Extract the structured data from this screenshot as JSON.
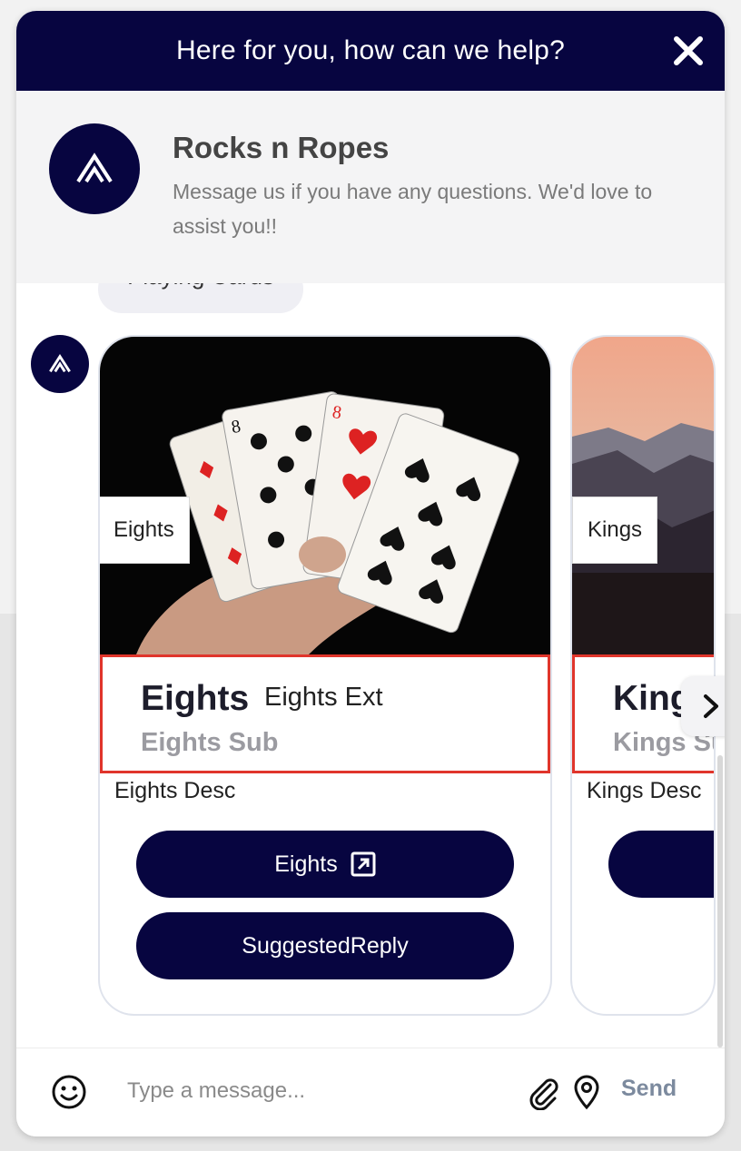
{
  "top_bar": {
    "title": "Here for you, how can we help?",
    "close_icon": "close-icon"
  },
  "header": {
    "brand_name": "Rocks n Ropes",
    "message": "Message us if you have any questions. We'd love to assist you!!"
  },
  "messages": {
    "previous_bubble": "Playing Cards",
    "cards": [
      {
        "image_tag": "Eights",
        "title": "Eights",
        "title_ext": "Eights Ext",
        "subtitle": "Eights Sub",
        "description": "Eights Desc",
        "buttons": [
          {
            "label": "Eights",
            "icon": "external-link-icon"
          },
          {
            "label": "SuggestedReply"
          }
        ]
      },
      {
        "image_tag": "Kings",
        "title": "Kings",
        "subtitle": "Kings Sub",
        "description": "Kings Desc"
      }
    ]
  },
  "composer": {
    "placeholder": "Type a message...",
    "send_label": "Send"
  },
  "colors": {
    "brand_navy": "#070540",
    "highlight_red": "#e0352b",
    "header_bg": "#f4f4f5"
  }
}
